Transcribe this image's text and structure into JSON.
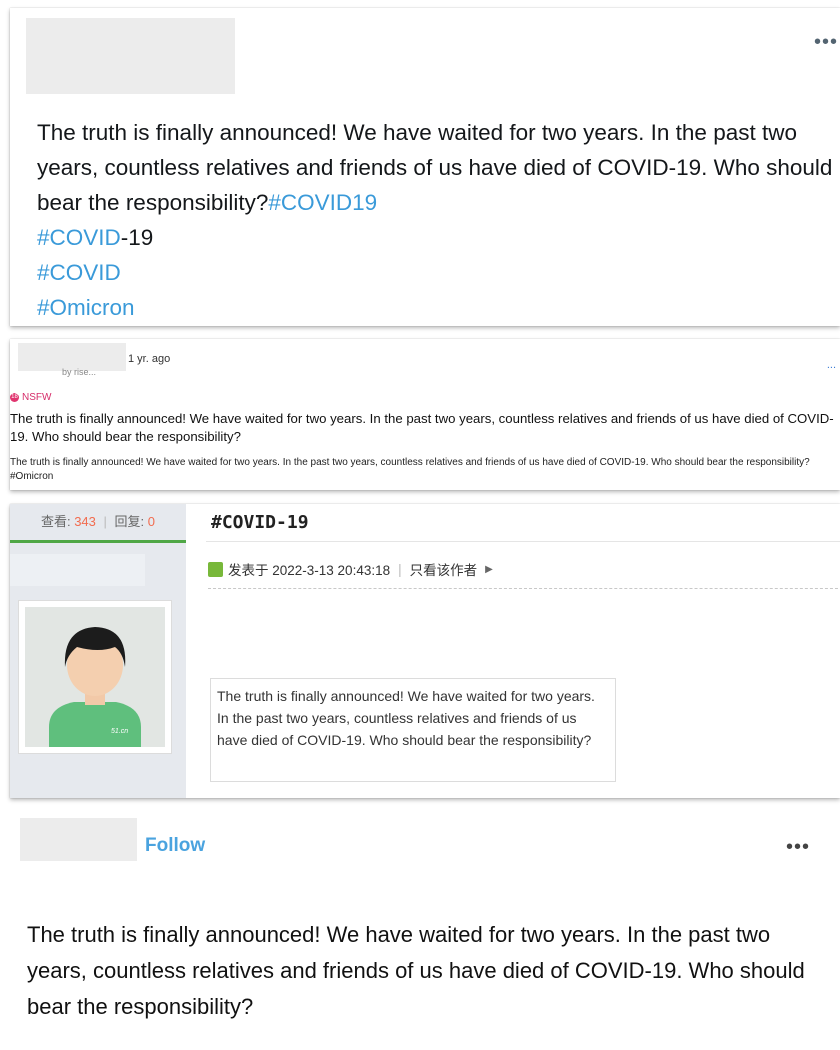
{
  "panel1": {
    "more": "•••",
    "text": "The truth is finally announced! We have waited for two years. In the past two years, countless relatives and friends of us have died of COVID-19. Who should bear the responsibility?",
    "inline_hashtag": "#COVID19",
    "line2_tag": "#COVID",
    "line2_suffix": "-19",
    "line3_tag": "#COVID",
    "line4_tag": "#Omicron"
  },
  "panel2": {
    "byline": "by rise...",
    "time": "1 yr. ago",
    "more": "...",
    "nsfw_label": "NSFW",
    "title": "The truth is finally announced! We have waited for two years. In the past two years, countless relatives and friends of us have died of COVID-19. Who should bear the responsibility?",
    "body": "The truth is finally announced! We have waited for two years. In the past two years, countless relatives and friends of us have died of COVID-19. Who should bear the responsibility?#Omicron"
  },
  "panel3": {
    "views_label": "查看:",
    "views": "343",
    "replies_label": "回复:",
    "replies": "0",
    "thread_title": "#COVID-19",
    "posted_label": "发表于 2022-3-13 20:43:18",
    "author_only": "只看该作者",
    "quote": "The truth is finally announced! We have waited for two years. In the past two years, countless relatives and friends of us have died of COVID-19. Who should bear the responsibility?",
    "avatar_shirt_text": "51.cn",
    "colors": {
      "accent_green": "#4fa746",
      "number_orange": "#f26c4f"
    }
  },
  "panel4": {
    "follow": "Follow",
    "more": "•••",
    "text": "The truth is finally announced! We have waited for two years. In the past two years, countless relatives and friends of us have died of COVID-19. Who should bear the responsibility?"
  }
}
